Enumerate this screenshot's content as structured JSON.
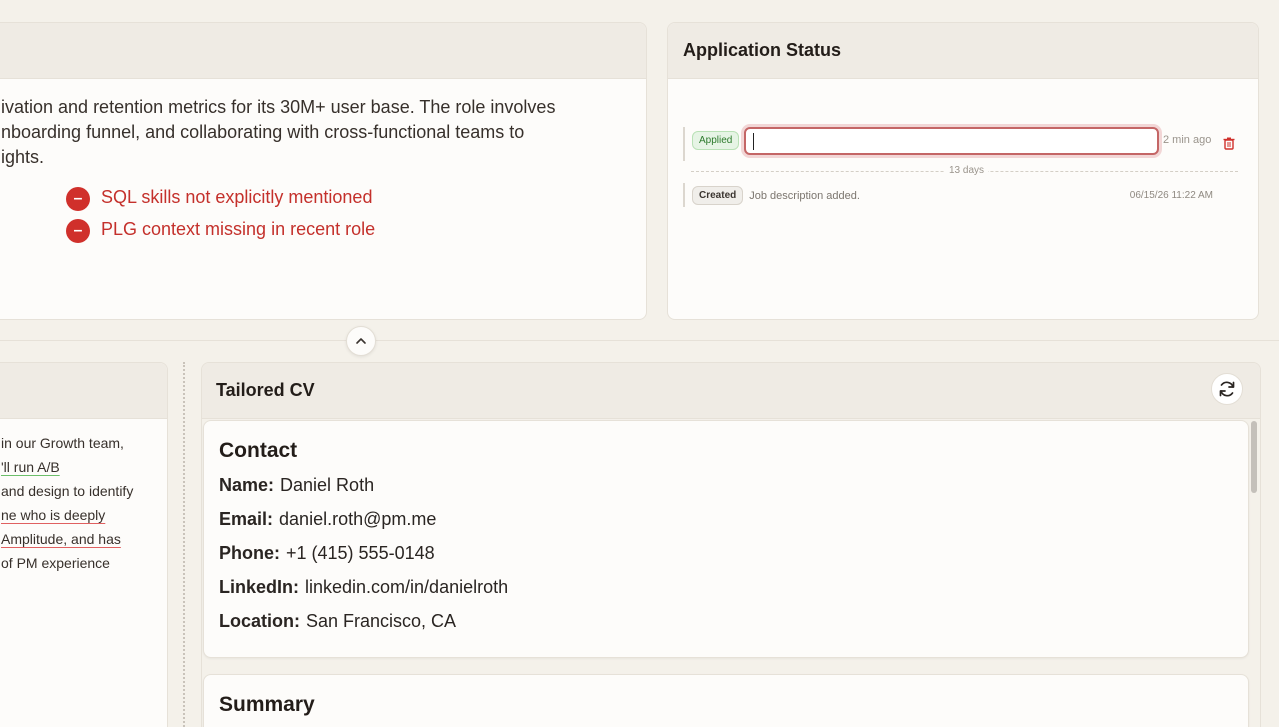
{
  "job": {
    "lines": [
      "ivation and retention metrics for its 30M+ user base. The role involves",
      "nboarding funnel, and collaborating with cross-functional teams to",
      "ights."
    ],
    "concerns": [
      "SQL skills not explicitly mentioned",
      "PLG context missing in recent role"
    ]
  },
  "status": {
    "title": "Application Status",
    "entries": [
      {
        "badge": "Applied",
        "note_value": "",
        "time": "2 min ago"
      },
      {
        "badge": "Created",
        "note": "Job description added.",
        "time": "06/15/26 11:22 AM"
      }
    ],
    "gap_label": "13 days"
  },
  "description": {
    "line1": "in our Growth team,",
    "line2": "'ll run A/B",
    "line3": "and design to identify",
    "line4": "ne who is deeply",
    "line5": " Amplitude, and has",
    "line6": "of PM experience"
  },
  "cv": {
    "title": "Tailored CV",
    "contact": {
      "heading": "Contact",
      "name_label": "Name:",
      "name": "Daniel Roth",
      "email_label": "Email:",
      "email": "daniel.roth@pm.me",
      "phone_label": "Phone:",
      "phone": "+1 (415) 555-0148",
      "linkedin_label": "LinkedIn:",
      "linkedin": "linkedin.com/in/danielroth",
      "location_label": "Location:",
      "location": "San Francisco, CA"
    },
    "summary_heading": "Summary"
  },
  "colors": {
    "accent_red": "#d0302b",
    "applied_green": "#2d7a2c"
  },
  "icons": {
    "minus": "minus-circle-icon",
    "trash": "trash-icon",
    "refresh": "refresh-icon",
    "chevron": "chevron-up-icon"
  }
}
